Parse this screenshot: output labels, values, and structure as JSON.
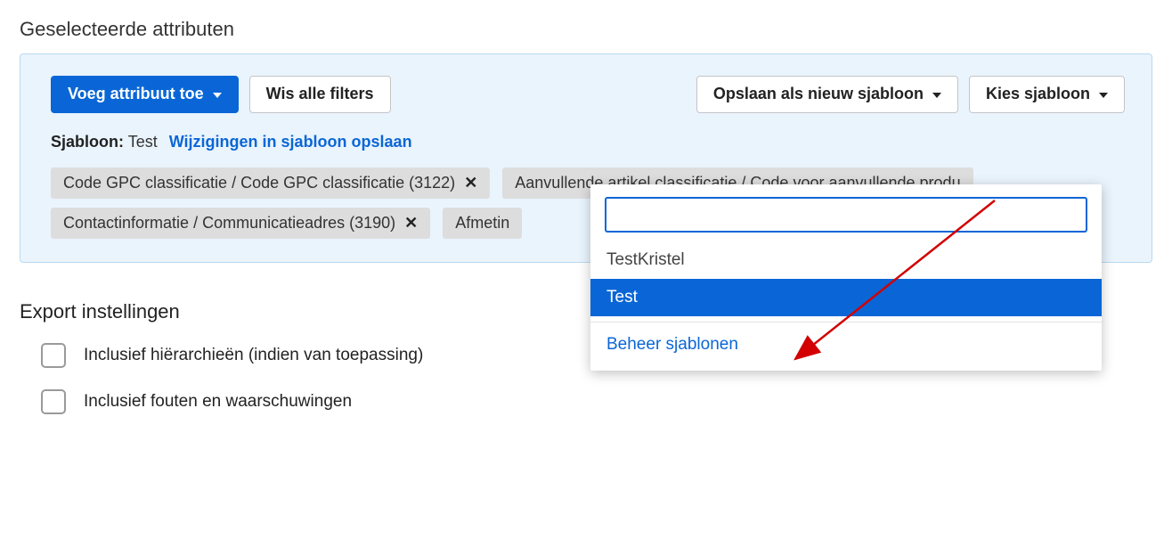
{
  "headings": {
    "selected_attributes": "Geselecteerde attributen",
    "export_settings": "Export instellingen"
  },
  "toolbar": {
    "add_attribute": "Voeg attribuut toe",
    "clear_filters": "Wis alle filters",
    "save_as_new_template": "Opslaan als nieuw sjabloon",
    "choose_template": "Kies sjabloon"
  },
  "template_line": {
    "label": "Sjabloon:",
    "name": "Test",
    "save_changes": "Wijzigingen in sjabloon opslaan"
  },
  "chips": [
    "Code GPC classificatie / Code GPC classificatie (3122)",
    "Aanvullende artikel classificatie / Code voor aanvullende produ",
    "Contactinformatie / Communicatieadres (3190)",
    "Afmetin"
  ],
  "popup": {
    "search_value": "",
    "options": [
      "TestKristel",
      "Test"
    ],
    "selected_index": 1,
    "manage": "Beheer sjablonen"
  },
  "export": {
    "hierarchies": "Inclusief hiërarchieën (indien van toepassing)",
    "errors": "Inclusief fouten en waarschuwingen"
  }
}
